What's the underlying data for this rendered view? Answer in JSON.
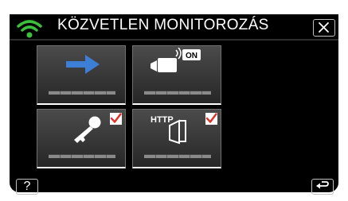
{
  "header": {
    "title": "KÖZVETLEN MONITOROZÁS",
    "wifi_icon": "wifi-icon",
    "wifi_color": "#3cbf3c",
    "close_icon": "close-icon"
  },
  "tiles": [
    {
      "icon": "arrow-right-icon",
      "label": "▬▬▬▬▬▬",
      "checked": false
    },
    {
      "icon": "camera-on-icon",
      "badge": "ON",
      "label": "▬▬▬▬▬▬",
      "checked": false
    },
    {
      "icon": "key-icon",
      "label": "▬▬▬▬▬▬",
      "checked": true
    },
    {
      "icon": "http-door-icon",
      "badge": "HTTP",
      "label": "▬▬▬▬▬▬",
      "checked": true
    }
  ],
  "footer": {
    "help_label": "?",
    "help_icon": "help-icon",
    "back_icon": "back-arrow-icon"
  },
  "colors": {
    "background": "#000000",
    "check_mark": "#e0302a",
    "arrow": "#3d7fd6"
  }
}
